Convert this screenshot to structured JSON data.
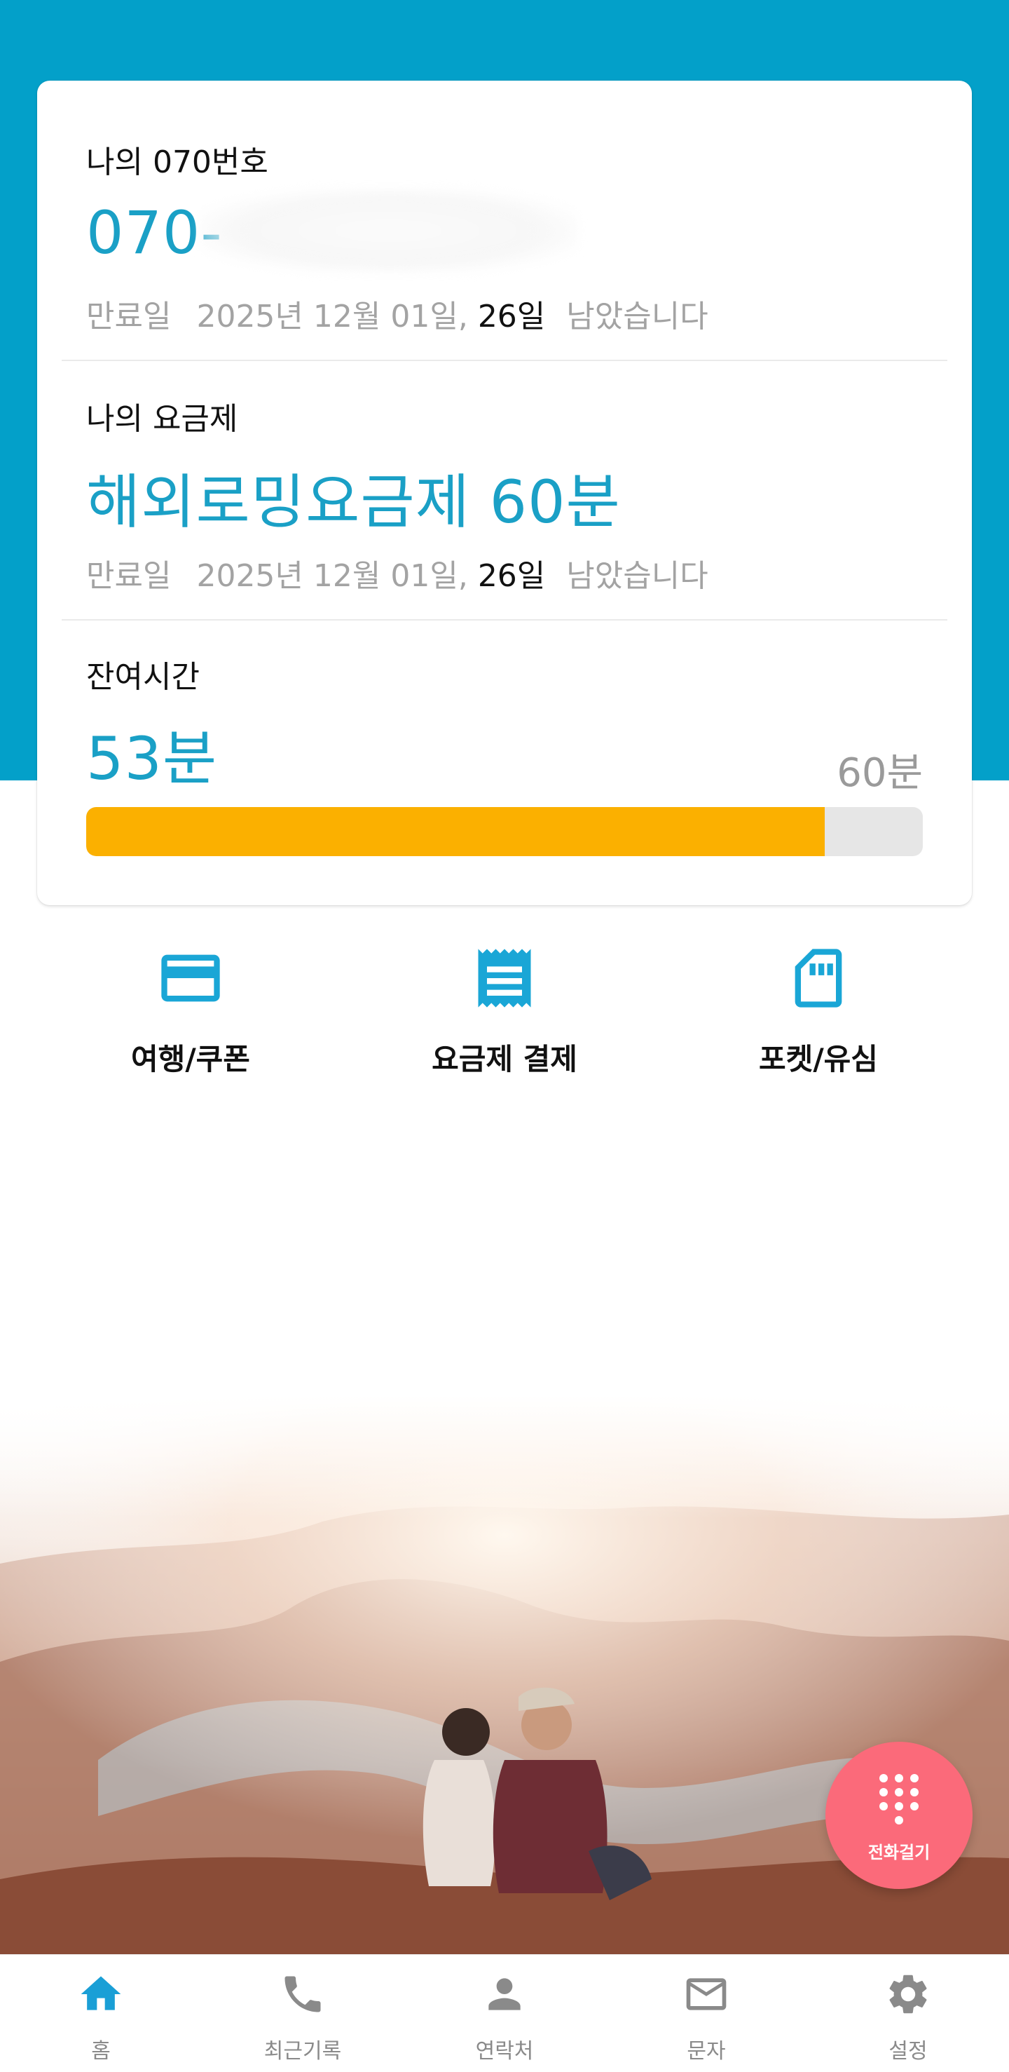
{
  "account": {
    "number_label": "나의 070번호",
    "number_prefix": "070-",
    "number_expiry_label": "만료일",
    "number_expiry_date": "2025년 12월 01일,",
    "number_days_left": "26일",
    "number_days_suffix": "남았습니다"
  },
  "plan": {
    "label": "나의 요금제",
    "name": "해외로밍요금제 60분",
    "expiry_label": "만료일",
    "expiry_date": "2025년 12월 01일,",
    "days_left": "26일",
    "days_suffix": "남았습니다"
  },
  "remaining": {
    "label": "잔여시간",
    "value": "53분",
    "total": "60분",
    "used_fraction": 0.883,
    "bar_color": "#fbb000"
  },
  "quick_menu": [
    {
      "icon": "card-icon",
      "label": "여행/쿠폰"
    },
    {
      "icon": "receipt-icon",
      "label": "요금제 결제"
    },
    {
      "icon": "sim-card-icon",
      "label": "포켓/유심"
    }
  ],
  "fab": {
    "icon": "dialpad-icon",
    "label": "전화걸기",
    "color": "#fb6a7a"
  },
  "bottom_nav": [
    {
      "icon": "home-icon",
      "label": "홈",
      "active": true
    },
    {
      "icon": "phone-icon",
      "label": "최근기록",
      "active": false
    },
    {
      "icon": "person-icon",
      "label": "연락처",
      "active": false
    },
    {
      "icon": "mail-icon",
      "label": "문자",
      "active": false
    },
    {
      "icon": "gear-icon",
      "label": "설정",
      "active": false
    }
  ],
  "colors": {
    "header_bg": "#03a0c9",
    "accent": "#1aa0c6",
    "nav_active": "#1a9fd6",
    "nav_inactive": "#8a8a8a"
  }
}
